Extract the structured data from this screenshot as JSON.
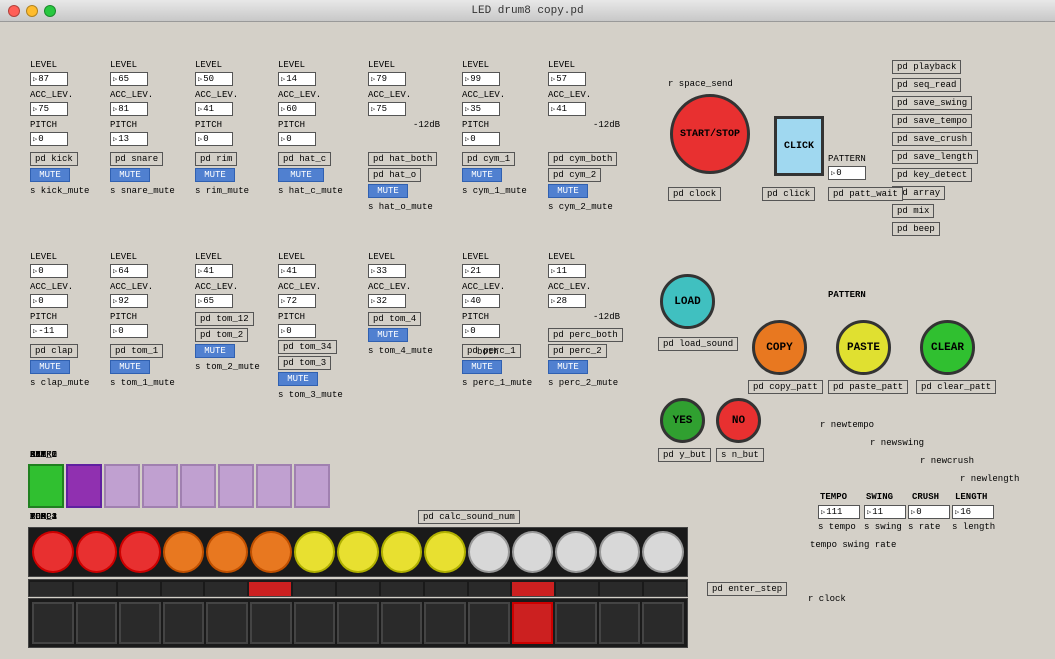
{
  "window": {
    "title": "LED drum8 copy.pd"
  },
  "right_panel": {
    "buttons": [
      "pd playback",
      "pd seq_read",
      "pd save_swing",
      "pd save_tempo",
      "pd save_crush",
      "pd save_length",
      "pd key_detect",
      "pd array",
      "pd mix",
      "pd beep"
    ]
  },
  "modules_row1": [
    {
      "id": "kick",
      "level": 87,
      "acc": 75,
      "pitch": 0,
      "label": "pd kick"
    },
    {
      "id": "snare",
      "level": 65,
      "acc": 81,
      "pitch": 13,
      "label": "pd snare"
    },
    {
      "id": "rim",
      "level": 50,
      "acc": 41,
      "pitch": 0,
      "label": "pd rim"
    },
    {
      "id": "hat_c",
      "level": 14,
      "acc": 60,
      "pitch": 0,
      "label": "pd hat_c"
    },
    {
      "id": "hat_o",
      "level": 79,
      "acc": 75,
      "pitch": "",
      "label": "pd hat_o",
      "extra": "pd hat_both"
    },
    {
      "id": "cym_1",
      "level": 99,
      "acc": 35,
      "pitch": 0,
      "label": "pd cym_1"
    },
    {
      "id": "cym_2",
      "level": 57,
      "acc": 41,
      "pitch": "",
      "label": "pd cym_2",
      "extra": "pd cym_both"
    }
  ],
  "modules_row2": [
    {
      "id": "clap",
      "level": 0,
      "acc": 0,
      "pitch": -11,
      "label": "pd clap"
    },
    {
      "id": "tom_1",
      "level": 64,
      "acc": 92,
      "pitch": 0,
      "label": "pd tom_1"
    },
    {
      "id": "tom_2",
      "level": 41,
      "acc": 65,
      "pitch": "",
      "label": "pd tom_2",
      "extra": "pd tom_12"
    },
    {
      "id": "tom_3",
      "level": 41,
      "acc": 72,
      "pitch": 0,
      "label": "pd tom_3",
      "extra": "pd tom_34"
    },
    {
      "id": "tom_4",
      "level": 33,
      "acc": 32,
      "pitch": "",
      "label": "pd tom_4"
    },
    {
      "id": "perc_1",
      "level": 21,
      "acc": 40,
      "pitch": 0,
      "label": "pd perc_1"
    },
    {
      "id": "perc_2",
      "level": 11,
      "acc": 28,
      "pitch": "",
      "label": "pd perc_2",
      "extra": "pd perc_both"
    }
  ],
  "start_stop": "START/STOP",
  "click_label": "CLICK",
  "pattern_label": "PATTERN",
  "clock_label": "pd clock",
  "click_pd": "pd click",
  "patt_wait": "pd patt_wait",
  "load_label": "LOAD",
  "copy_label": "COPY",
  "paste_label": "PASTE",
  "clear_label": "CLEAR",
  "yes_label": "YES",
  "no_label": "NO",
  "y_but": "pd y_but",
  "n_but": "s n_but",
  "space_send": "r space_send",
  "copy_patt": "pd copy_patt",
  "paste_patt": "pd paste_patt",
  "clear_patt": "pd clear_patt",
  "load_sound": "pd load_sound",
  "pattern2_label": "PATTERN",
  "seq_labels_row1": [
    "KICK",
    "SNARE",
    "RIM",
    "HAT_C",
    "HAT_O",
    "CYM_1",
    "CYM_2",
    "ACC"
  ],
  "seq_labels_row2": [
    "CLAP",
    "TOM_1",
    "TOM_2",
    "TOM_3",
    "TOM_4",
    "PERC1",
    "PERC2",
    "ACC"
  ],
  "calc_sound": "pd calc_sound_num",
  "tempo_label": "TEMPO",
  "swing_label": "SWING",
  "crush_label": "CRUSH",
  "length_label": "LENGTH",
  "tempo_val": "111",
  "swing_val": "11",
  "crush_val": "0",
  "length_val": "16",
  "tempo_s": "s tempo",
  "swing_s": "s swing",
  "rate_s": "s rate",
  "length_s": "s length",
  "newtempo": "r newtempo",
  "newswing": "r newswing",
  "newcrush": "r newcrush",
  "newlength": "r newlength",
  "tempo_swing_rate": "tempo swing rate",
  "enter_step": "pd enter_step",
  "clock_r": "r clock",
  "both_label": "both"
}
